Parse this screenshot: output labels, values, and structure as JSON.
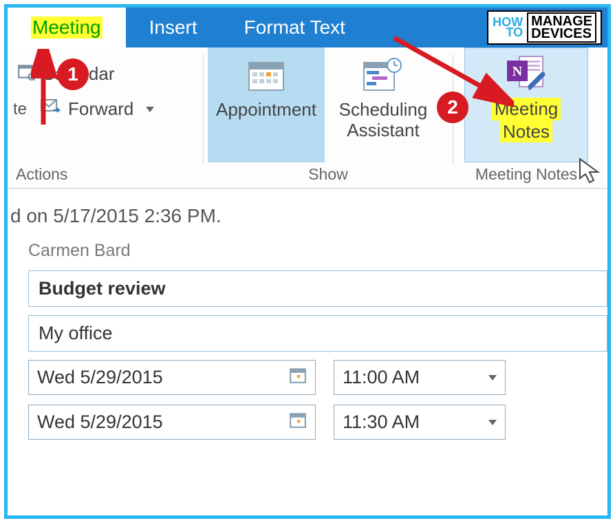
{
  "tabs": {
    "active": "Meeting",
    "insert": "Insert",
    "format": "Format Text"
  },
  "logo": {
    "l1": "HOW",
    "l2": "TO",
    "r1": "MANAGE",
    "r2": "DEVICES"
  },
  "ribbon": {
    "actions": {
      "calendar": "Calendar",
      "forward": "Forward",
      "label": "Actions",
      "truncated": "te"
    },
    "show": {
      "appointment": "Appointment",
      "scheduling1": "Scheduling",
      "scheduling2": "Assistant",
      "label": "Show"
    },
    "notes": {
      "l1": "Meeting",
      "l2": "Notes",
      "label": "Meeting Notes"
    }
  },
  "form": {
    "received": "d on 5/17/2015 2:36 PM.",
    "organizer": "Carmen Bard",
    "subject": "Budget review",
    "location": "My office",
    "start_date": "Wed 5/29/2015",
    "start_time": "11:00 AM",
    "end_date": "Wed 5/29/2015",
    "end_time": "11:30 AM"
  },
  "annotations": {
    "n1": "1",
    "n2": "2"
  }
}
